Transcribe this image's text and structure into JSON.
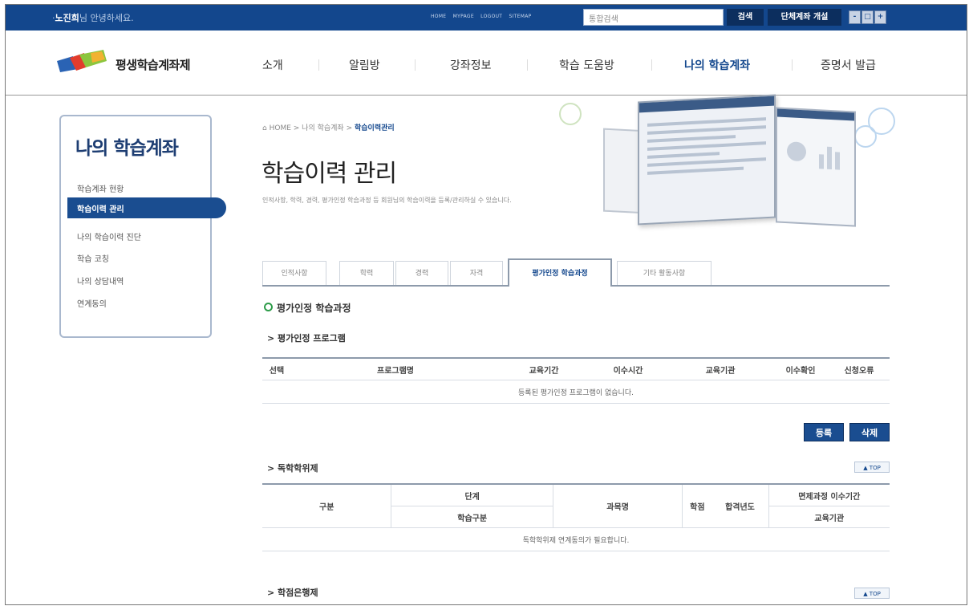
{
  "topbar": {
    "user": "노진희",
    "greeting_suffix": "님 안녕하세요.",
    "links": [
      "HOME",
      "MYPAGE",
      "LOGOUT",
      "SITEMAP"
    ],
    "search_placeholder": "통합검색",
    "search_button": "검색",
    "group_account_button": "단체계좌 개설",
    "font_sizes": [
      "-",
      "□",
      "+"
    ]
  },
  "gnb": {
    "logo_text": "평생학습계좌제",
    "items": [
      "소개",
      "알림방",
      "강좌정보",
      "학습 도움방",
      "나의 학습계좌",
      "증명서 발급"
    ],
    "active_index": 4
  },
  "lnb": {
    "title": "나의 학습계좌",
    "items": [
      "학습계좌 현황",
      "학습이력 관리",
      "나의 학습이력 진단",
      "학습 코칭",
      "나의 상담내역",
      "연계동의"
    ],
    "active_index": 1
  },
  "header": {
    "breadcrumb_home": "HOME",
    "breadcrumb_mid": "나의 학습계좌",
    "breadcrumb_current": "학습이력관리",
    "title": "학습이력 관리",
    "desc": "인적사항, 학력, 경력, 평가인정 학습과정 등 회원님의 학습이력을 등록/관리하실 수 있습니다."
  },
  "tabs": [
    "인적사항",
    "학력",
    "경력",
    "자격",
    "평가인정 학습과정",
    "기타 활동사항"
  ],
  "active_tab": 4,
  "section_title": "평가인정 학습과정",
  "program": {
    "title": "평가인정 프로그램",
    "columns": [
      "선택",
      "프로그램명",
      "교육기간",
      "이수시간",
      "교육기관",
      "이수확인",
      "신청오류"
    ],
    "empty": "등록된 평가인정 프로그램이 없습니다.",
    "register_button": "등록",
    "delete_button": "삭제"
  },
  "self_study": {
    "title": "독학학위제",
    "top_label": "TOP",
    "col_gubun": "구분",
    "col_stage": "단계",
    "col_study_type": "학습구분",
    "col_subject": "과목명",
    "col_credit": "학점",
    "col_pass_year": "합격년도",
    "col_exempt": "면제과정 이수기간",
    "col_institution": "교육기관",
    "empty": "독학학위제 연계동의가 필요합니다."
  },
  "credit_bank": {
    "title": "학점은행제",
    "top_label": "TOP"
  },
  "colors": {
    "primary": "#13478d",
    "dark": "#0c2e5e",
    "green": "#2c9b48"
  }
}
